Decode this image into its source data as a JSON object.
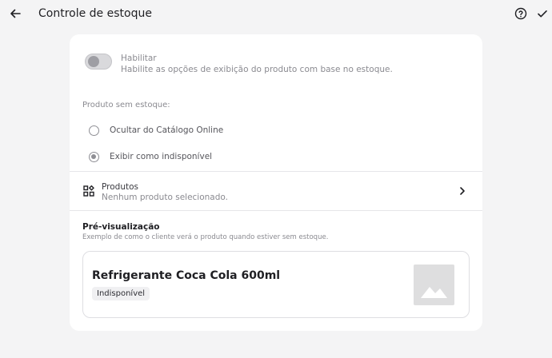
{
  "header": {
    "title": "Controle de estoque",
    "back_icon": "arrow-left-icon",
    "help_icon": "help-circle-icon",
    "confirm_icon": "check-icon"
  },
  "enable": {
    "label": "Habilitar",
    "description": "Habilite as opções de exibição do produto com base no estoque.",
    "enabled": false
  },
  "out_of_stock": {
    "title": "Produto sem estoque:",
    "options": [
      {
        "label": "Ocultar do Catálogo Online",
        "selected": false
      },
      {
        "label": "Exibir como indisponível",
        "selected": true
      }
    ]
  },
  "products": {
    "title": "Produtos",
    "subtitle": "Nenhum produto selecionado.",
    "icon": "grid-shapes-icon"
  },
  "preview": {
    "title": "Pré-visualização",
    "description": "Exemplo de como o cliente verá o produto quando estiver sem estoque.",
    "product_name": "Refrigerante Coca Cola 600ml",
    "badge": "Indisponível"
  },
  "colors": {
    "background": "#f4f4f5",
    "card": "#ffffff",
    "muted_text": "#8a8a90",
    "primary_text": "#1f1f23"
  }
}
